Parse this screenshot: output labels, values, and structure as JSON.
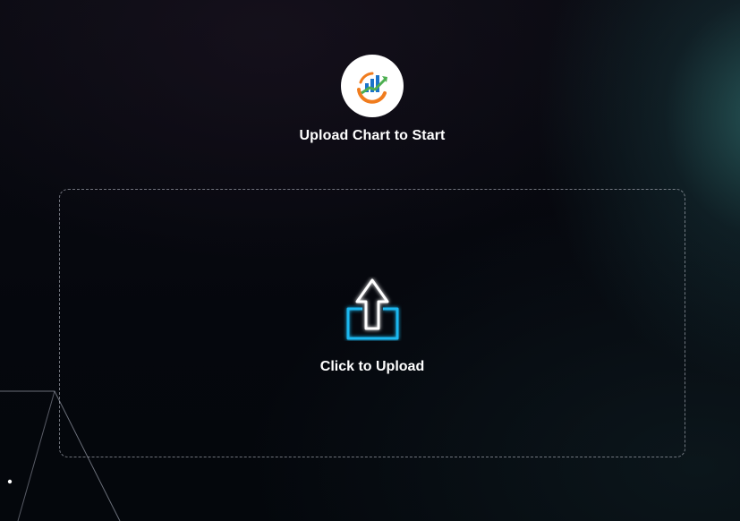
{
  "app": {
    "logo_icon": "chart-growth-logo-icon",
    "title": "Upload Chart to Start"
  },
  "upload": {
    "icon": "upload-arrow-icon",
    "label": "Click to Upload",
    "accent_color": "#1ab8f0"
  }
}
